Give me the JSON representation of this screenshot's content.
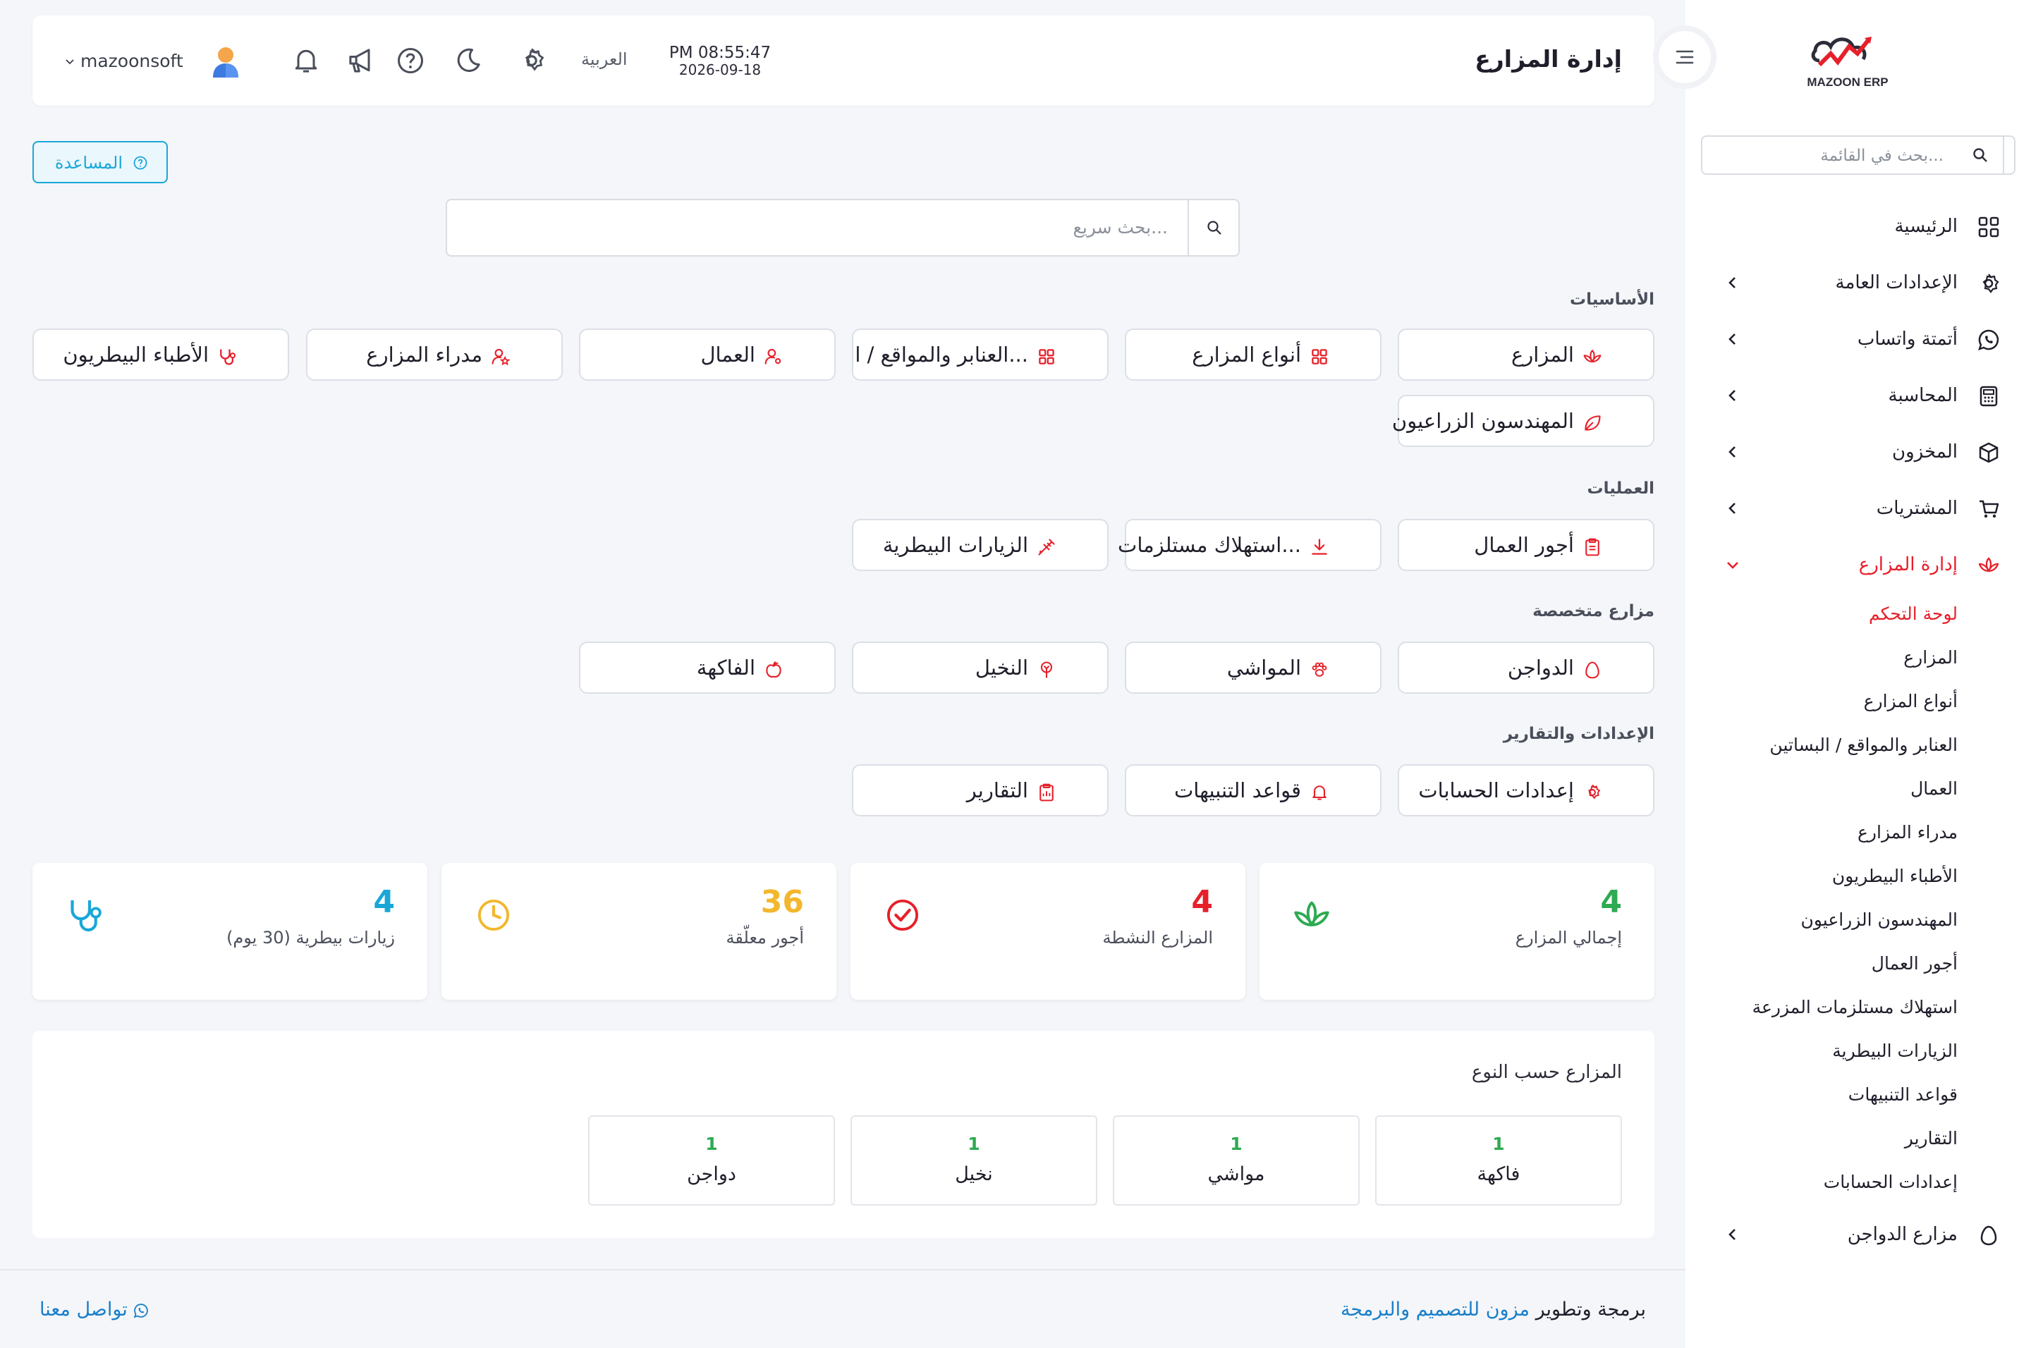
{
  "app": {
    "title": "إدارة المزارع",
    "logo_text": "MAZOON ERP"
  },
  "sidebar": {
    "search_placeholder": "بحث في القائمة...",
    "items": [
      {
        "label": "الرئيسية",
        "icon": "grid-icon",
        "expandable": false
      },
      {
        "label": "الإعدادات العامة",
        "icon": "gear-icon",
        "expandable": true
      },
      {
        "label": "أتمتة واتساب",
        "icon": "whatsapp-icon",
        "expandable": true
      },
      {
        "label": "المحاسبة",
        "icon": "calculator-icon",
        "expandable": true
      },
      {
        "label": "المخزون",
        "icon": "box-icon",
        "expandable": true
      },
      {
        "label": "المشتريات",
        "icon": "cart-icon",
        "expandable": true
      },
      {
        "label": "إدارة المزارع",
        "icon": "lotus-icon",
        "expandable": true,
        "active": true
      }
    ],
    "subitems": [
      "لوحة التحكم",
      "المزارع",
      "أنواع المزارع",
      "العنابر والمواقع / البساتين",
      "العمال",
      "مدراء المزارع",
      "الأطباء البيطريون",
      "المهندسون الزراعيون",
      "أجور العمال",
      "استهلاك مستلزمات المزرعة",
      "الزيارات البيطرية",
      "قواعد التنبيهات",
      "التقارير",
      "إعدادات الحسابات"
    ],
    "active_subitem": "لوحة التحكم",
    "last_item": {
      "label": "مزارع الدواجن",
      "icon": "egg-icon"
    }
  },
  "header": {
    "page_title": "إدارة المزارع",
    "time": "PM 08:55:47",
    "date": "2026-09-18",
    "language": "العربية",
    "username": "mazoonsoft"
  },
  "help_label": "المساعدة",
  "quick_search_placeholder": "بحث سريع...",
  "sections": {
    "basics": {
      "title": "الأساسيات",
      "buttons": [
        "المزارع",
        "أنواع المزارع",
        "العنابر والمواقع / ا...",
        "العمال",
        "مدراء المزارع",
        "الأطباء البيطريون",
        "المهندسون الزراعيون"
      ]
    },
    "operations": {
      "title": "العمليات",
      "buttons": [
        "أجور العمال",
        "استهلاك مستلزمات...",
        "الزيارات البيطرية"
      ]
    },
    "specialized": {
      "title": "مزارع متخصصة",
      "buttons": [
        "الدواجن",
        "المواشي",
        "النخيل",
        "الفاكهة"
      ]
    },
    "settings": {
      "title": "الإعدادات والتقارير",
      "buttons": [
        "إعدادات الحسابات",
        "قواعد التنبيهات",
        "التقارير"
      ]
    }
  },
  "stats": [
    {
      "value": "4",
      "label": "إجمالي المزارع",
      "color": "#2eaa52",
      "icon": "lotus-icon"
    },
    {
      "value": "4",
      "label": "المزارع النشطة",
      "color": "#e6202a",
      "icon": "check-circle-icon"
    },
    {
      "value": "36",
      "label": "أجور معلّقة",
      "color": "#f2b72c",
      "icon": "clock-icon"
    },
    {
      "value": "4",
      "label": "زيارات بيطرية (30 يوم)",
      "color": "#1aa7d8",
      "icon": "stethoscope-icon"
    }
  ],
  "farms_by_type": {
    "title": "المزارع حسب النوع",
    "items": [
      {
        "count": "1",
        "label": "فاكهة"
      },
      {
        "count": "1",
        "label": "مواشي"
      },
      {
        "count": "1",
        "label": "نخيل"
      },
      {
        "count": "1",
        "label": "دواجن"
      }
    ]
  },
  "footer": {
    "prefix": "برمجة وتطوير",
    "company": "مزون للتصميم والبرمجة",
    "contact": "تواصل معنا"
  },
  "colors": {
    "accent": "#e6202a",
    "info": "#1aa7d8",
    "success": "#2eaa52",
    "warning": "#f2b72c"
  }
}
